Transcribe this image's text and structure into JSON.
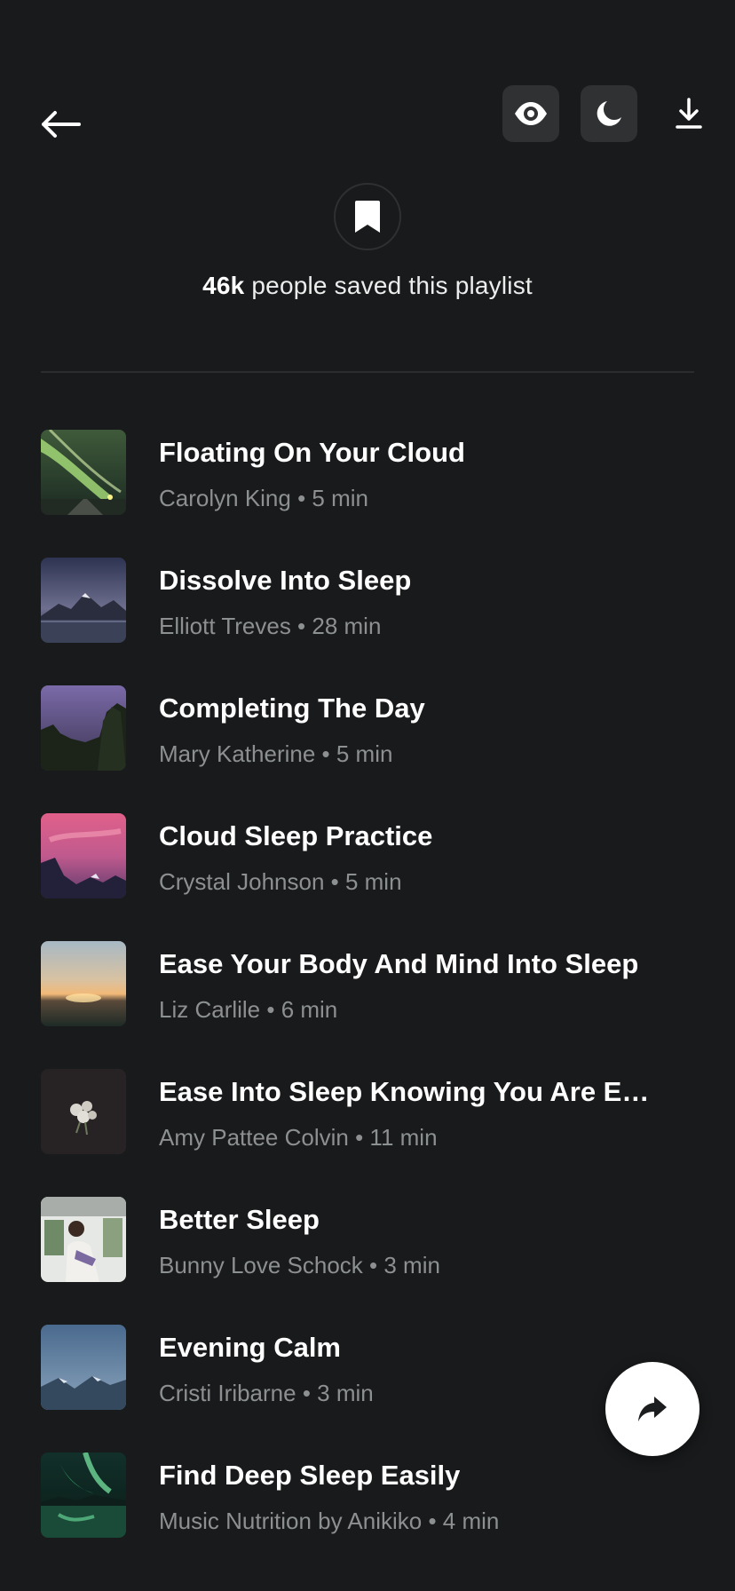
{
  "header": {
    "back_icon": "arrow-left-icon",
    "visibility_icon": "eye-icon",
    "sleep_mode_icon": "moon-icon",
    "download_icon": "download-icon"
  },
  "save": {
    "icon": "bookmark-icon",
    "count": "46k",
    "text": " people saved this playlist"
  },
  "tracks": [
    {
      "title": "Floating On Your Cloud",
      "meta": "Carolyn King • 5 min",
      "thumb": "aurora-road"
    },
    {
      "title": "Dissolve Into Sleep",
      "meta": "Elliott Treves • 28 min",
      "thumb": "mountain-lake-dusk"
    },
    {
      "title": "Completing The Day",
      "meta": "Mary Katherine • 5 min",
      "thumb": "purple-sky-trees"
    },
    {
      "title": "Cloud Sleep Practice",
      "meta": "Crystal Johnson • 5 min",
      "thumb": "pink-sky-mountains"
    },
    {
      "title": "Ease Your Body And Mind Into Sleep",
      "meta": "Liz Carlile • 6 min",
      "thumb": "sunset-horizon"
    },
    {
      "title": "Ease Into Sleep Knowing You Are Enou...",
      "meta": "Amy Pattee Colvin • 11 min",
      "thumb": "flowers-dark"
    },
    {
      "title": "Better Sleep",
      "meta": "Bunny Love Schock • 3 min",
      "thumb": "woman-portrait"
    },
    {
      "title": "Evening Calm",
      "meta": "Cristi Iribarne • 3 min",
      "thumb": "moon-mountains"
    },
    {
      "title": "Find Deep Sleep Easily",
      "meta": "Music Nutrition by Anikiko • 4 min",
      "thumb": "green-aurora-lake"
    }
  ],
  "share": {
    "icon": "share-arrow-icon"
  },
  "colors": {
    "background": "#181a1b",
    "button_bg": "#2f3132",
    "meta_text": "#8d9091",
    "fab": "#ffffff"
  }
}
